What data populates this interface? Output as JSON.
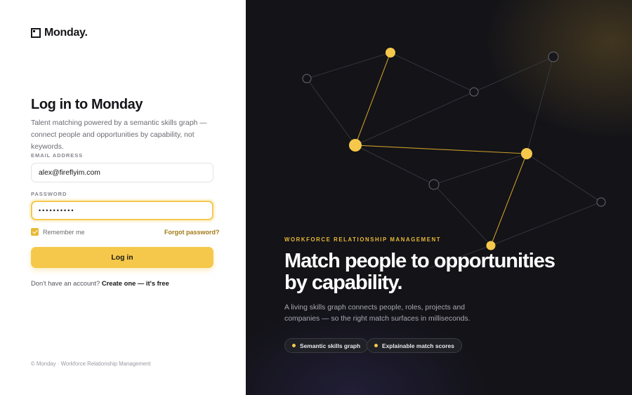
{
  "brand": {
    "name": "Monday."
  },
  "login": {
    "title": "Log in to Monday",
    "subtitle": "Talent matching powered by a semantic skills graph — connect people and opportunities by capability, not keywords.",
    "email_label": "EMAIL ADDRESS",
    "email_value": "alex@fireflyim.com",
    "password_label": "PASSWORD",
    "password_value": "••••••••••",
    "remember_label": "Remember me",
    "remember_checked": true,
    "forgot_label": "Forgot password?",
    "submit_label": "Log in",
    "signup_prompt": "Don't have an account?",
    "signup_link": "Create one — it's free"
  },
  "footer": {
    "text": "© Monday · Workforce Relationship Management"
  },
  "hero": {
    "eyebrow": "WORKFORCE RELATIONSHIP MANAGEMENT",
    "headline": "Match people to opportunities by capability.",
    "description": "A living skills graph connects people, roles, projects and companies — so the right match surfaces in milliseconds.",
    "pills": [
      "Semantic skills graph",
      "Explainable match scores"
    ]
  },
  "colors": {
    "accent": "#f5c84b",
    "dark_bg": "#131318",
    "text_primary": "#16161a"
  },
  "icons": {
    "logo": "logo-mark-icon",
    "checkbox": "check-icon",
    "pill": "dot-icon"
  }
}
